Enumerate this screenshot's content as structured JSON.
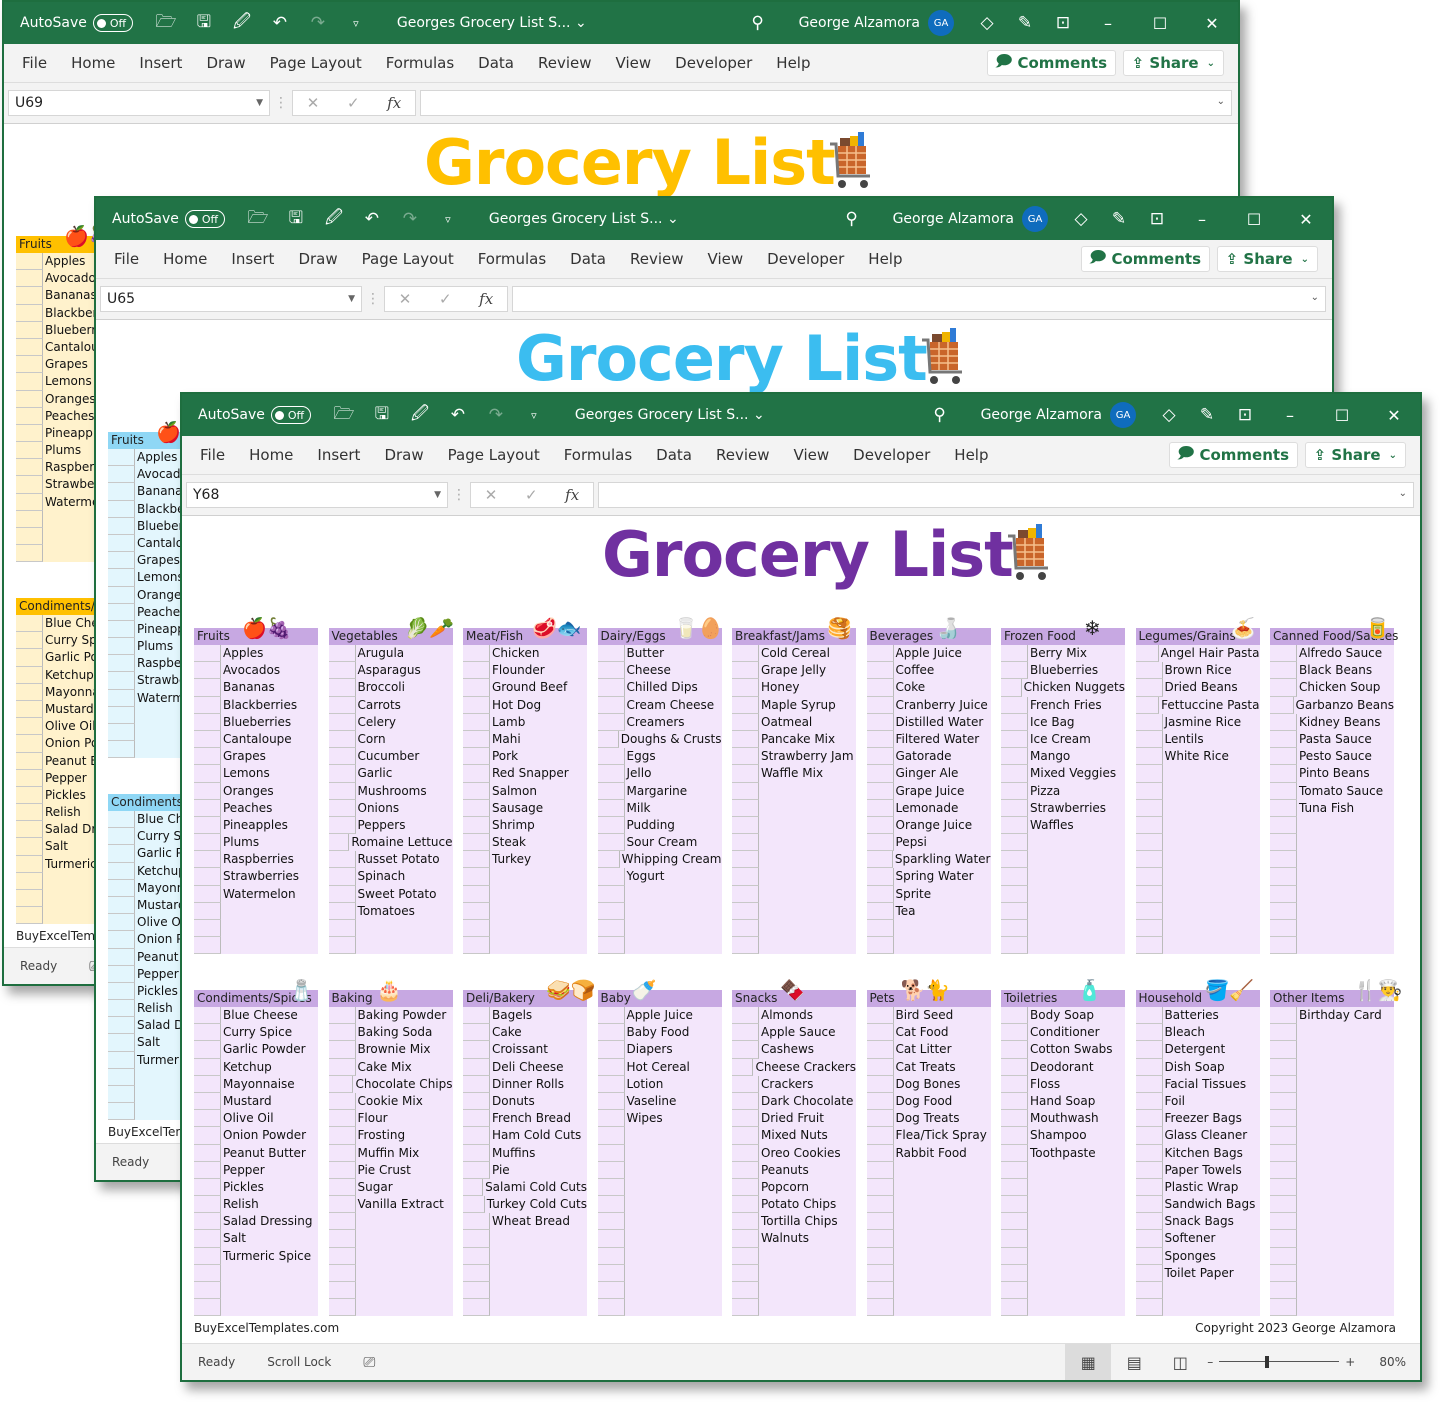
{
  "common": {
    "autosave_label": "AutoSave",
    "autosave_state": "Off",
    "doc_title": "Georges Grocery List S...",
    "user_name": "George Alzamora",
    "user_initials": "GA",
    "menu_tabs": [
      "File",
      "Home",
      "Insert",
      "Draw",
      "Page Layout",
      "Formulas",
      "Data",
      "Review",
      "View",
      "Developer",
      "Help"
    ],
    "comments_label": "Comments",
    "share_label": "Share",
    "status_ready": "Ready",
    "status_scroll_lock": "Scroll Lock",
    "zoom_level": "80%",
    "zoom_fraction": 0.8,
    "footer_left": "BuyExcelTemplates.com",
    "footer_right": "Copyright 2023 George Alzamora",
    "sheet_title": "Grocery List"
  },
  "windows": [
    {
      "name_box": "U69",
      "theme": "orange",
      "title_color": "#ffc000"
    },
    {
      "name_box": "U65",
      "theme": "blue",
      "title_color": "#3bbdf0"
    },
    {
      "name_box": "Y68",
      "theme": "purple",
      "title_color": "#7030a0"
    }
  ],
  "categories": [
    {
      "name": "Fruits",
      "icon": "🍎🍇",
      "items": [
        "Apples",
        "Avocados",
        "Bananas",
        "Blackberries",
        "Blueberries",
        "Cantaloupe",
        "Grapes",
        "Lemons",
        "Oranges",
        "Peaches",
        "Pineapples",
        "Plums",
        "Raspberries",
        "Strawberries",
        "Watermelon"
      ]
    },
    {
      "name": "Vegetables",
      "icon": "🥬🥕",
      "items": [
        "Arugula",
        "Asparagus",
        "Broccoli",
        "Carrots",
        "Celery",
        "Corn",
        "Cucumber",
        "Garlic",
        "Mushrooms",
        "Onions",
        "Peppers",
        "Romaine Lettuce",
        "Russet Potato",
        "Spinach",
        "Sweet Potato",
        "Tomatoes"
      ]
    },
    {
      "name": "Meat/Fish",
      "icon": "🥩🐟",
      "items": [
        "Chicken",
        "Flounder",
        "Ground Beef",
        "Hot Dog",
        "Lamb",
        "Mahi",
        "Pork",
        "Red Snapper",
        "Salmon",
        "Sausage",
        "Shrimp",
        "Steak",
        "Turkey"
      ]
    },
    {
      "name": "Dairy/Eggs",
      "icon": "🥛🥚",
      "items": [
        "Butter",
        "Cheese",
        "Chilled Dips",
        "Cream Cheese",
        "Creamers",
        "Doughs & Crusts",
        "Eggs",
        "Jello",
        "Margarine",
        "Milk",
        "Pudding",
        "Sour Cream",
        "Whipping Cream",
        "Yogurt"
      ]
    },
    {
      "name": "Breakfast/Jams",
      "icon": "🥞",
      "items": [
        "Cold Cereal",
        "Grape Jelly",
        "Honey",
        "Maple Syrup",
        "Oatmeal",
        "Pancake Mix",
        "Strawberry Jam",
        "Waffle Mix"
      ]
    },
    {
      "name": "Beverages",
      "icon": "🍶",
      "items": [
        "Apple Juice",
        "Coffee",
        "Coke",
        "Cranberry Juice",
        "Distilled Water",
        "Filtered Water",
        "Gatorade",
        "Ginger Ale",
        "Grape Juice",
        "Lemonade",
        "Orange Juice",
        "Pepsi",
        "Sparkling Water",
        "Spring Water",
        "Sprite",
        "Tea"
      ]
    },
    {
      "name": "Frozen Food",
      "icon": "❄",
      "items": [
        "Berry Mix",
        "Blueberries",
        "Chicken Nuggets",
        "French Fries",
        "Ice Bag",
        "Ice Cream",
        "Mango",
        "Mixed Veggies",
        "Pizza",
        "Strawberries",
        "Waffles"
      ]
    },
    {
      "name": "Legumes/Grains",
      "icon": "🍝",
      "items": [
        "Angel Hair Pasta",
        "Brown Rice",
        "Dried Beans",
        "Fettuccine Pasta",
        "Jasmine Rice",
        "Lentils",
        "White Rice"
      ]
    },
    {
      "name": "Canned Food/Sauces",
      "icon": "🥫",
      "items": [
        "Alfredo Sauce",
        "Black Beans",
        "Chicken Soup",
        "Garbanzo Beans",
        "Kidney Beans",
        "Pasta Sauce",
        "Pesto Sauce",
        "Pinto Beans",
        "Tomato Sauce",
        "Tuna Fish"
      ]
    },
    {
      "name": "Condiments/Spices",
      "icon": "🧂",
      "items": [
        "Blue Cheese",
        "Curry Spice",
        "Garlic Powder",
        "Ketchup",
        "Mayonnaise",
        "Mustard",
        "Olive Oil",
        "Onion Powder",
        "Peanut Butter",
        "Pepper",
        "Pickles",
        "Relish",
        "Salad Dressing",
        "Salt",
        "Turmeric Spice"
      ]
    },
    {
      "name": "Baking",
      "icon": "🎂",
      "items": [
        "Baking Powder",
        "Baking Soda",
        "Brownie Mix",
        "Cake Mix",
        "Chocolate Chips",
        "Cookie Mix",
        "Flour",
        "Frosting",
        "Muffin Mix",
        "Pie Crust",
        "Sugar",
        "Vanilla Extract"
      ]
    },
    {
      "name": "Deli/Bakery",
      "icon": "🥪🍞",
      "items": [
        "Bagels",
        "Cake",
        "Croissant",
        "Deli Cheese",
        "Dinner Rolls",
        "Donuts",
        "French Bread",
        "Ham Cold Cuts",
        "Muffins",
        "Pie",
        "Salami Cold Cuts",
        "Turkey Cold Cuts",
        "Wheat Bread"
      ]
    },
    {
      "name": "Baby",
      "icon": "🍼",
      "items": [
        "Apple Juice",
        "Baby Food",
        "Diapers",
        "Hot Cereal",
        "Lotion",
        "Vaseline",
        "Wipes"
      ]
    },
    {
      "name": "Snacks",
      "icon": "🍫",
      "items": [
        "Almonds",
        "Apple Sauce",
        "Cashews",
        "Cheese Crackers",
        "Crackers",
        "Dark Chocolate",
        "Dried Fruit",
        "Mixed Nuts",
        "Oreo Cookies",
        "Peanuts",
        "Popcorn",
        "Potato Chips",
        "Tortilla Chips",
        "Walnuts"
      ]
    },
    {
      "name": "Pets",
      "icon": "🐕🐈",
      "items": [
        "Bird Seed",
        "Cat Food",
        "Cat Litter",
        "Cat Treats",
        "Dog Bones",
        "Dog Food",
        "Dog Treats",
        "Flea/Tick Spray",
        "Rabbit Food"
      ]
    },
    {
      "name": "Toiletries",
      "icon": "🧴",
      "items": [
        "Body Soap",
        "Conditioner",
        "Cotton Swabs",
        "Deodorant",
        "Floss",
        "Hand Soap",
        "Mouthwash",
        "Shampoo",
        "Toothpaste"
      ]
    },
    {
      "name": "Household",
      "icon": "🪣🧹",
      "items": [
        "Batteries",
        "Bleach",
        "Detergent",
        "Dish Soap",
        "Facial Tissues",
        "Foil",
        "Freezer Bags",
        "Glass Cleaner",
        "Kitchen Bags",
        "Paper Towels",
        "Plastic Wrap",
        "Sandwich Bags",
        "Snack Bags",
        "Softener",
        "Sponges",
        "Toilet Paper"
      ]
    },
    {
      "name": "Other Items",
      "icon": "🍴👨‍🍳",
      "items": [
        "Birthday Card"
      ]
    }
  ]
}
